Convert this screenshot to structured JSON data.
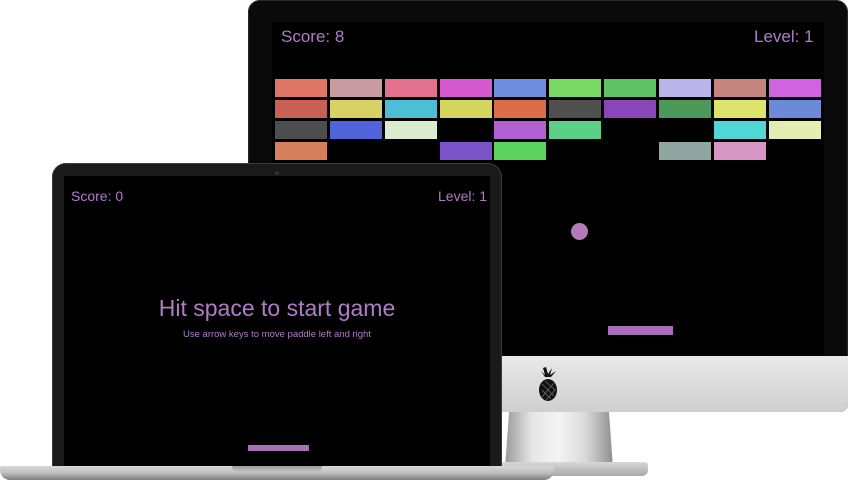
{
  "desktop": {
    "score_text": "Score: 8",
    "level_text": "Level: 1",
    "bricks": [
      [
        "#e07566",
        "#c99aa0",
        "#e3718e",
        "#d659d2",
        "#6f8ee0",
        "#79d965",
        "#5fc465",
        "#b9b4ea",
        "#c5847d",
        "#d063e0"
      ],
      [
        "#c86154",
        "#d8d166",
        "#4cbfd6",
        "#d4d65e",
        "#dc6d4b",
        "#505050",
        "#8a46b8",
        "#4c9a5a",
        "#dde46a",
        "#6c8ad8"
      ],
      [
        "#4d4d4d",
        "#5063d8",
        "#d9ecce",
        null,
        "#b35fd4",
        "#5bcf85",
        null,
        null,
        "#51d6d6",
        "#e4edb2"
      ],
      [
        "#d67f5a",
        null,
        null,
        "#7a54c8",
        "#5ad35f",
        null,
        null,
        "#8fa6a0",
        "#d795c6",
        null
      ]
    ],
    "ball_color": "#b27ab8",
    "paddle_color": "#a76fb6"
  },
  "laptop": {
    "score_text": "Score: 0",
    "level_text": "Level: 1",
    "start_title": "Hit space to start game",
    "start_hint": "Use arrow keys to move paddle left and right",
    "paddle_color": "#a76fb6"
  },
  "colors": {
    "text_accent": "#b07cc8",
    "screen_bg": "#000000"
  },
  "icons": {
    "desktop_logo": "pineapple-icon"
  }
}
